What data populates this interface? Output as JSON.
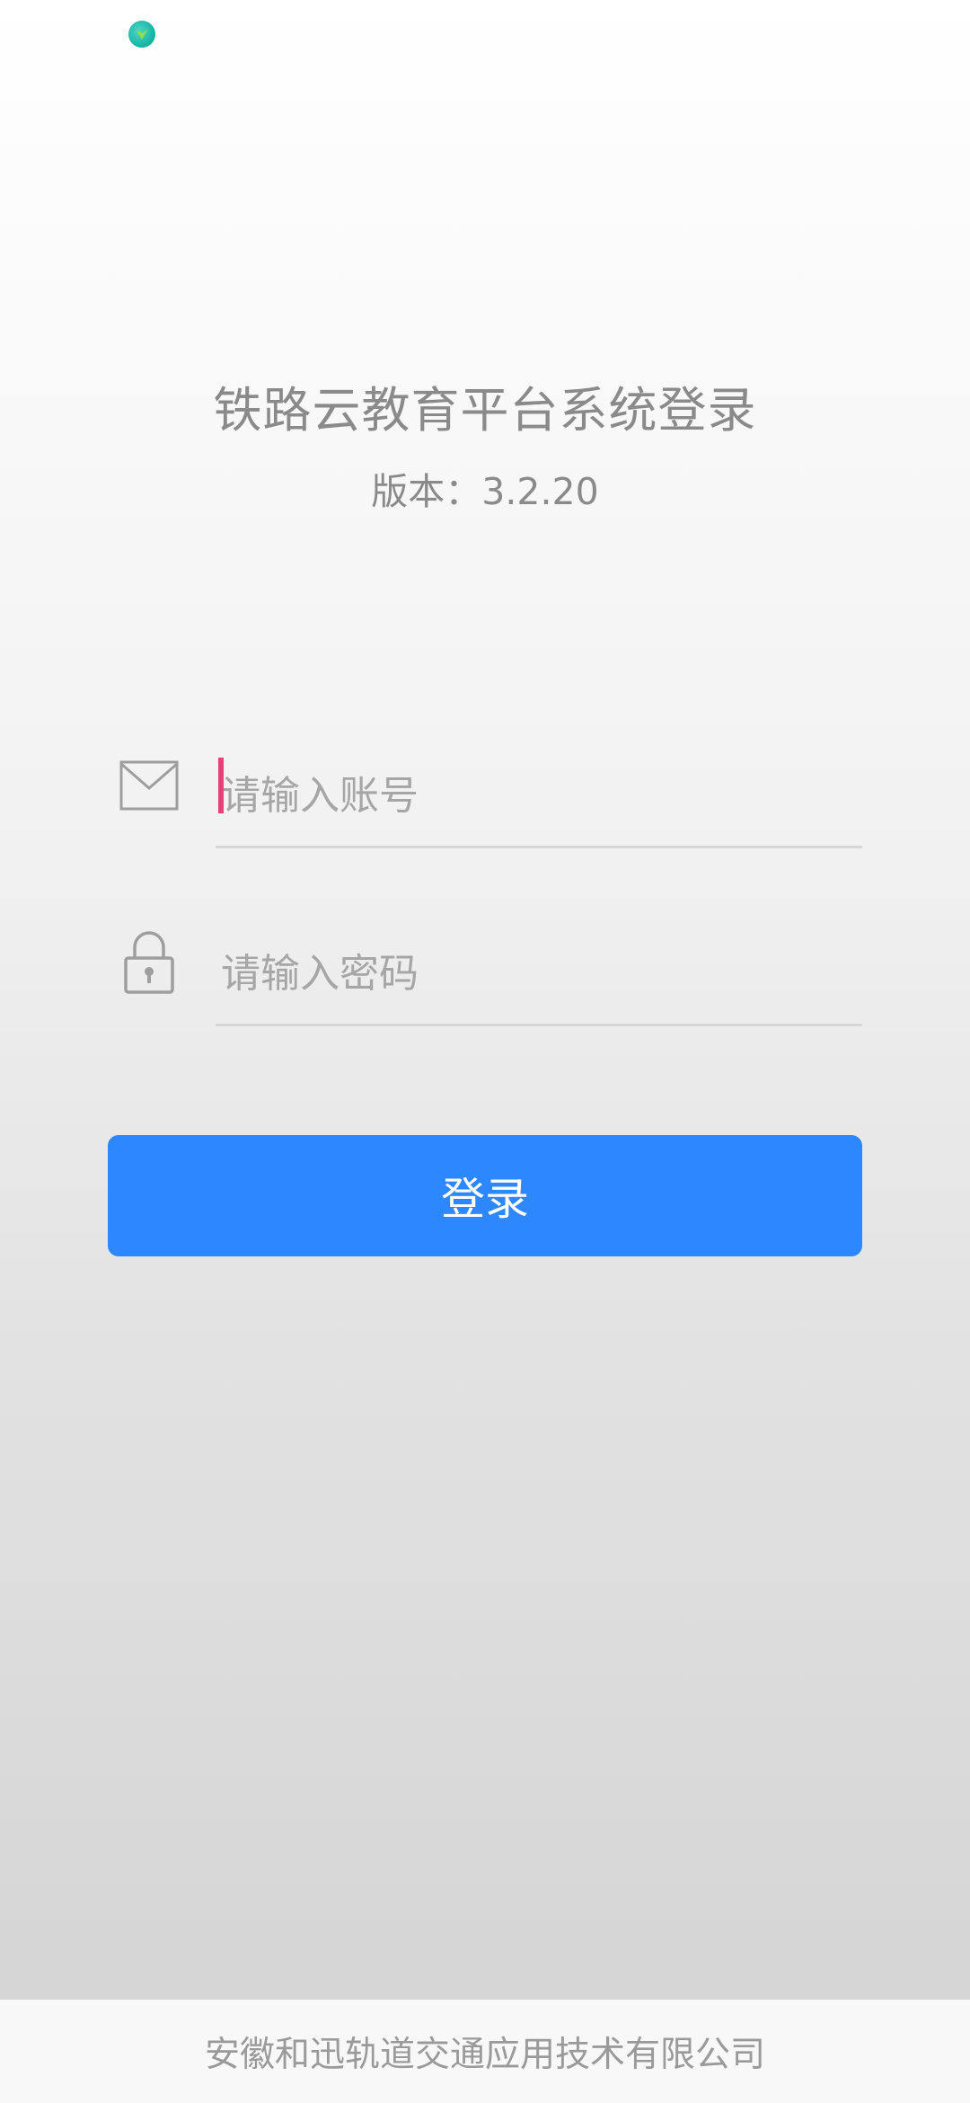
{
  "status_bar": {
    "app_icon": "app-notification-icon"
  },
  "login": {
    "title": "铁路云教育平台系统登录",
    "version": "版本：3.2.20",
    "account": {
      "icon": "mail-icon",
      "placeholder": "请输入账号",
      "value": ""
    },
    "password": {
      "icon": "lock-icon",
      "placeholder": "请输入密码",
      "value": ""
    },
    "submit_label": "登录"
  },
  "footer": {
    "company": "安徽和迅轨道交通应用技术有限公司"
  },
  "colors": {
    "accent": "#2d87ff",
    "caret": "#e8417a",
    "text_muted": "#8a8a8a"
  }
}
